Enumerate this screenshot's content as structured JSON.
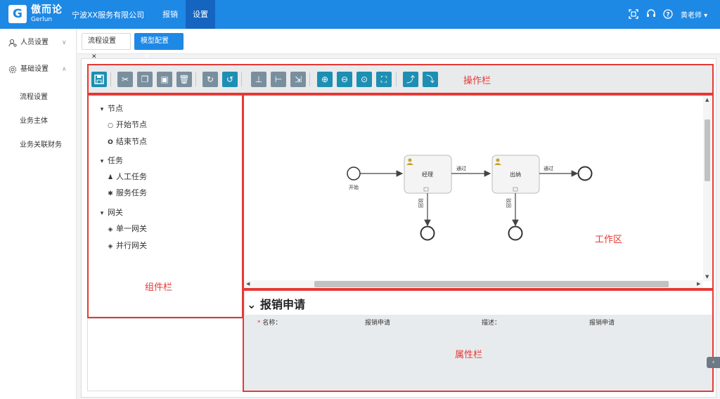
{
  "header": {
    "logo_letter": "G",
    "brand_cn": "傲而论",
    "brand_en": "Gerlun",
    "company": "宁波XX服务有限公司",
    "nav": [
      "报销",
      "设置"
    ],
    "active_nav": "设置",
    "user": "黄老师 ▾",
    "icons": [
      "fullscreen-icon",
      "headset-icon",
      "help-icon"
    ]
  },
  "sidebar": {
    "groups": [
      {
        "label": "人员设置",
        "icon": "user-settings-icon",
        "chevron": "∨"
      },
      {
        "label": "基础设置",
        "icon": "gear-icon",
        "chevron": "∧"
      }
    ],
    "items": [
      "流程设置",
      "业务主体",
      "业务关联财务"
    ]
  },
  "tabs": [
    {
      "label": "流程设置",
      "close": "✕",
      "active": false
    },
    {
      "label": "模型配置",
      "close": "✕",
      "active": true
    }
  ],
  "toolbar": {
    "label": "操作栏",
    "buttons": [
      "save-icon",
      "cut-icon",
      "copy-icon",
      "paste-icon",
      "delete-icon",
      "redo-icon",
      "undo-icon",
      "align-vertical-icon",
      "align-horizontal-icon",
      "resize-icon",
      "zoom-in-icon",
      "zoom-out-icon",
      "zoom-actual-icon",
      "fit-icon",
      "add-sequence-flow-icon",
      "remove-sequence-flow-icon"
    ]
  },
  "palette": {
    "label": "组件栏",
    "sections": [
      {
        "title": "节点",
        "items": [
          {
            "label": "开始节点",
            "symbol": "○"
          },
          {
            "label": "结束节点",
            "symbol": "O"
          }
        ]
      },
      {
        "title": "任务",
        "items": [
          {
            "label": "人工任务",
            "symbol": "♟"
          },
          {
            "label": "服务任务",
            "symbol": "✱"
          }
        ]
      },
      {
        "title": "网关",
        "items": [
          {
            "label": "单一网关",
            "symbol": "◈"
          },
          {
            "label": "并行网关",
            "symbol": "◈"
          }
        ]
      }
    ],
    "toggle": "▾"
  },
  "workarea": {
    "label": "工作区",
    "start_label": "开始",
    "task1": "经理",
    "task2": "出纳",
    "edge_pass_1": "通过",
    "edge_pass_2": "通过",
    "edge_reject_1": "驳回",
    "edge_reject_2": "驳回",
    "colors": {
      "red_frame": "#e53935",
      "teal": "#1d8fb3"
    }
  },
  "properties": {
    "label": "属性栏",
    "toggle": "⌄",
    "title": "报销申请",
    "required_mark": "*",
    "name_label": "名称：",
    "name_value": "报销申请",
    "desc_label": "描述：",
    "desc_value": "报销申请"
  }
}
